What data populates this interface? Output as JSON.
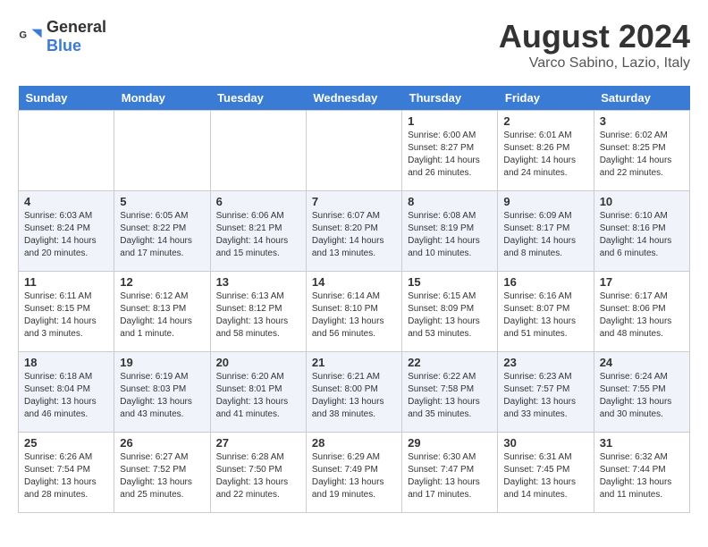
{
  "header": {
    "logo_general": "General",
    "logo_blue": "Blue",
    "month_year": "August 2024",
    "location": "Varco Sabino, Lazio, Italy"
  },
  "weekdays": [
    "Sunday",
    "Monday",
    "Tuesday",
    "Wednesday",
    "Thursday",
    "Friday",
    "Saturday"
  ],
  "weeks": [
    [
      {
        "day": "",
        "info": ""
      },
      {
        "day": "",
        "info": ""
      },
      {
        "day": "",
        "info": ""
      },
      {
        "day": "",
        "info": ""
      },
      {
        "day": "1",
        "info": "Sunrise: 6:00 AM\nSunset: 8:27 PM\nDaylight: 14 hours and 26 minutes."
      },
      {
        "day": "2",
        "info": "Sunrise: 6:01 AM\nSunset: 8:26 PM\nDaylight: 14 hours and 24 minutes."
      },
      {
        "day": "3",
        "info": "Sunrise: 6:02 AM\nSunset: 8:25 PM\nDaylight: 14 hours and 22 minutes."
      }
    ],
    [
      {
        "day": "4",
        "info": "Sunrise: 6:03 AM\nSunset: 8:24 PM\nDaylight: 14 hours and 20 minutes."
      },
      {
        "day": "5",
        "info": "Sunrise: 6:05 AM\nSunset: 8:22 PM\nDaylight: 14 hours and 17 minutes."
      },
      {
        "day": "6",
        "info": "Sunrise: 6:06 AM\nSunset: 8:21 PM\nDaylight: 14 hours and 15 minutes."
      },
      {
        "day": "7",
        "info": "Sunrise: 6:07 AM\nSunset: 8:20 PM\nDaylight: 14 hours and 13 minutes."
      },
      {
        "day": "8",
        "info": "Sunrise: 6:08 AM\nSunset: 8:19 PM\nDaylight: 14 hours and 10 minutes."
      },
      {
        "day": "9",
        "info": "Sunrise: 6:09 AM\nSunset: 8:17 PM\nDaylight: 14 hours and 8 minutes."
      },
      {
        "day": "10",
        "info": "Sunrise: 6:10 AM\nSunset: 8:16 PM\nDaylight: 14 hours and 6 minutes."
      }
    ],
    [
      {
        "day": "11",
        "info": "Sunrise: 6:11 AM\nSunset: 8:15 PM\nDaylight: 14 hours and 3 minutes."
      },
      {
        "day": "12",
        "info": "Sunrise: 6:12 AM\nSunset: 8:13 PM\nDaylight: 14 hours and 1 minute."
      },
      {
        "day": "13",
        "info": "Sunrise: 6:13 AM\nSunset: 8:12 PM\nDaylight: 13 hours and 58 minutes."
      },
      {
        "day": "14",
        "info": "Sunrise: 6:14 AM\nSunset: 8:10 PM\nDaylight: 13 hours and 56 minutes."
      },
      {
        "day": "15",
        "info": "Sunrise: 6:15 AM\nSunset: 8:09 PM\nDaylight: 13 hours and 53 minutes."
      },
      {
        "day": "16",
        "info": "Sunrise: 6:16 AM\nSunset: 8:07 PM\nDaylight: 13 hours and 51 minutes."
      },
      {
        "day": "17",
        "info": "Sunrise: 6:17 AM\nSunset: 8:06 PM\nDaylight: 13 hours and 48 minutes."
      }
    ],
    [
      {
        "day": "18",
        "info": "Sunrise: 6:18 AM\nSunset: 8:04 PM\nDaylight: 13 hours and 46 minutes."
      },
      {
        "day": "19",
        "info": "Sunrise: 6:19 AM\nSunset: 8:03 PM\nDaylight: 13 hours and 43 minutes."
      },
      {
        "day": "20",
        "info": "Sunrise: 6:20 AM\nSunset: 8:01 PM\nDaylight: 13 hours and 41 minutes."
      },
      {
        "day": "21",
        "info": "Sunrise: 6:21 AM\nSunset: 8:00 PM\nDaylight: 13 hours and 38 minutes."
      },
      {
        "day": "22",
        "info": "Sunrise: 6:22 AM\nSunset: 7:58 PM\nDaylight: 13 hours and 35 minutes."
      },
      {
        "day": "23",
        "info": "Sunrise: 6:23 AM\nSunset: 7:57 PM\nDaylight: 13 hours and 33 minutes."
      },
      {
        "day": "24",
        "info": "Sunrise: 6:24 AM\nSunset: 7:55 PM\nDaylight: 13 hours and 30 minutes."
      }
    ],
    [
      {
        "day": "25",
        "info": "Sunrise: 6:26 AM\nSunset: 7:54 PM\nDaylight: 13 hours and 28 minutes."
      },
      {
        "day": "26",
        "info": "Sunrise: 6:27 AM\nSunset: 7:52 PM\nDaylight: 13 hours and 25 minutes."
      },
      {
        "day": "27",
        "info": "Sunrise: 6:28 AM\nSunset: 7:50 PM\nDaylight: 13 hours and 22 minutes."
      },
      {
        "day": "28",
        "info": "Sunrise: 6:29 AM\nSunset: 7:49 PM\nDaylight: 13 hours and 19 minutes."
      },
      {
        "day": "29",
        "info": "Sunrise: 6:30 AM\nSunset: 7:47 PM\nDaylight: 13 hours and 17 minutes."
      },
      {
        "day": "30",
        "info": "Sunrise: 6:31 AM\nSunset: 7:45 PM\nDaylight: 13 hours and 14 minutes."
      },
      {
        "day": "31",
        "info": "Sunrise: 6:32 AM\nSunset: 7:44 PM\nDaylight: 13 hours and 11 minutes."
      }
    ]
  ]
}
